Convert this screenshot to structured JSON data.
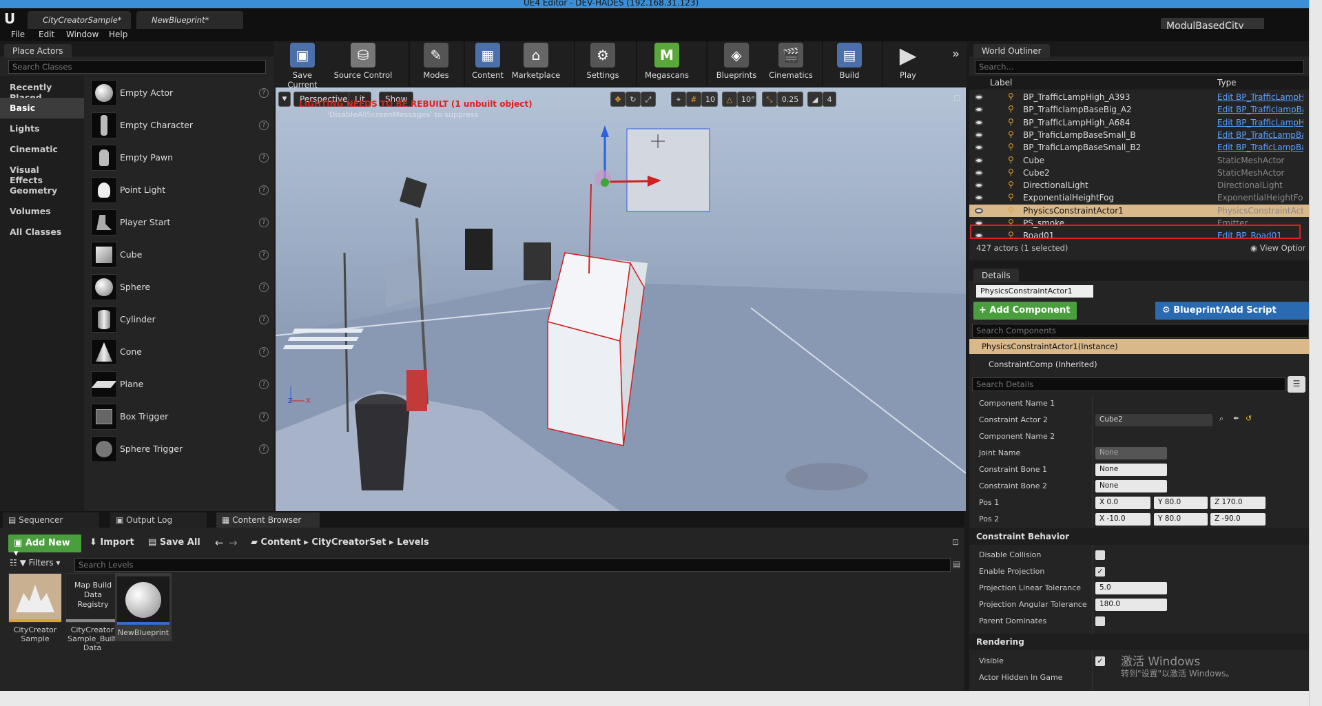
{
  "window": {
    "title": "UE4 Editor - DEV-HADES (192.168.31.123)"
  },
  "doc_tabs": [
    "CityCreatorSample*",
    "NewBlueprint*"
  ],
  "project_name": "ModulBasedCity",
  "menu": [
    "File",
    "Edit",
    "Window",
    "Help"
  ],
  "place_actors": {
    "tab": "Place Actors",
    "search_placeholder": "Search Classes",
    "categories": [
      "Recently Placed",
      "Basic",
      "Lights",
      "Cinematic",
      "Visual Effects",
      "Geometry",
      "Volumes",
      "All Classes"
    ],
    "selected_category": "Basic",
    "actors": [
      "Empty Actor",
      "Empty Character",
      "Empty Pawn",
      "Point Light",
      "Player Start",
      "Cube",
      "Sphere",
      "Cylinder",
      "Cone",
      "Plane",
      "Box Trigger",
      "Sphere Trigger"
    ]
  },
  "toolbar": [
    "Save Current",
    "Source Control",
    "Modes",
    "Content",
    "Marketplace",
    "Settings",
    "Megascans",
    "Blueprints",
    "Cinematics",
    "Build",
    "Play"
  ],
  "viewport": {
    "perspective": "Perspective",
    "lit": "Lit",
    "show": "Show",
    "warning": "LIGHTING NEEDS TO BE REBUILT (1 unbuilt object)",
    "suppress": "'DisableAllScreenMessages' to suppress",
    "grid": "10",
    "rot": "10°",
    "scale": "0.25",
    "cam": "4"
  },
  "outliner": {
    "tab": "World Outliner",
    "search_placeholder": "Search...",
    "col_label": "Label",
    "col_type": "Type",
    "rows": [
      {
        "label": "BP_TrafficLampHigh_A393",
        "type": "Edit BP_TrafficLampH",
        "link": true
      },
      {
        "label": "BP_TrafficlampBaseBig_A2",
        "type": "Edit BP_TrafficlampBa",
        "link": true
      },
      {
        "label": "BP_TrafficLampHigh_A684",
        "type": "Edit BP_TrafficLampH",
        "link": true
      },
      {
        "label": "BP_TraficLampBaseSmall_B",
        "type": "Edit BP_TraficLampBa",
        "link": true
      },
      {
        "label": "BP_TraficLampBaseSmall_B2",
        "type": "Edit BP_TraficLampBa",
        "link": true
      },
      {
        "label": "Cube",
        "type": "StaticMeshActor",
        "link": false
      },
      {
        "label": "Cube2",
        "type": "StaticMeshActor",
        "link": false
      },
      {
        "label": "DirectionalLight",
        "type": "DirectionalLight",
        "link": false
      },
      {
        "label": "ExponentialHeightFog",
        "type": "ExponentialHeightFog",
        "link": false
      },
      {
        "label": "PhysicsConstraintActor1",
        "type": "PhysicsConstraintActor",
        "link": false
      },
      {
        "label": "PS_smoke",
        "type": "Emitter",
        "link": false
      },
      {
        "label": "Road01",
        "type": "Edit BP_Road01",
        "link": true
      }
    ],
    "status": "427 actors (1 selected)",
    "view_options": "View Options"
  },
  "details": {
    "tab": "Details",
    "name": "PhysicsConstraintActor1",
    "add_component": "+ Add Component",
    "blueprint": "Blueprint/Add Script",
    "search_components": "Search Components",
    "instance": "PhysicsConstraintActor1(Instance)",
    "inherited": "ConstraintComp (Inherited)",
    "search_details": "Search Details",
    "rows": [
      {
        "label": "Component Name 1",
        "value": ""
      },
      {
        "label": "Constraint Actor 2",
        "value": "Cube2"
      },
      {
        "label": "Component Name 2",
        "value": ""
      },
      {
        "label": "Joint Name",
        "value": "None"
      },
      {
        "label": "Constraint Bone 1",
        "value": "None"
      },
      {
        "label": "Constraint Bone 2",
        "value": "None"
      }
    ],
    "pos1": {
      "label": "Pos 1",
      "x": "0.0",
      "y": "80.0",
      "z": "170.0"
    },
    "pos2": {
      "label": "Pos 2",
      "x": "-10.0",
      "y": "80.0",
      "z": "-90.0"
    },
    "section_behavior": "Constraint Behavior",
    "behavior": [
      {
        "label": "Disable Collision",
        "value": ""
      },
      {
        "label": "Enable Projection",
        "value": "✓"
      },
      {
        "label": "Projection Linear Tolerance",
        "value": "5.0"
      },
      {
        "label": "Projection Angular Tolerance",
        "value": "180.0"
      },
      {
        "label": "Parent Dominates",
        "value": ""
      }
    ],
    "section_rendering": "Rendering",
    "visible": "Visible",
    "hidden": "Actor Hidden In Game"
  },
  "bottom_tabs": [
    "Sequencer",
    "Output Log",
    "Content Browser"
  ],
  "content_browser": {
    "add_new": "Add New",
    "import": "Import",
    "save_all": "Save All",
    "path": [
      "Content",
      "CityCreatorSet",
      "Levels"
    ],
    "filters": "Filters",
    "search_placeholder": "Search Levels",
    "assets": [
      {
        "name": "CityCreator Sample"
      },
      {
        "name": "CityCreator Sample_Built Data",
        "thumb": "Map Build Data Registry"
      },
      {
        "name": "NewBlueprint"
      }
    ]
  },
  "watermark": {
    "line1": "激活 Windows",
    "line2": "转到\"设置\"以激活 Windows。"
  }
}
